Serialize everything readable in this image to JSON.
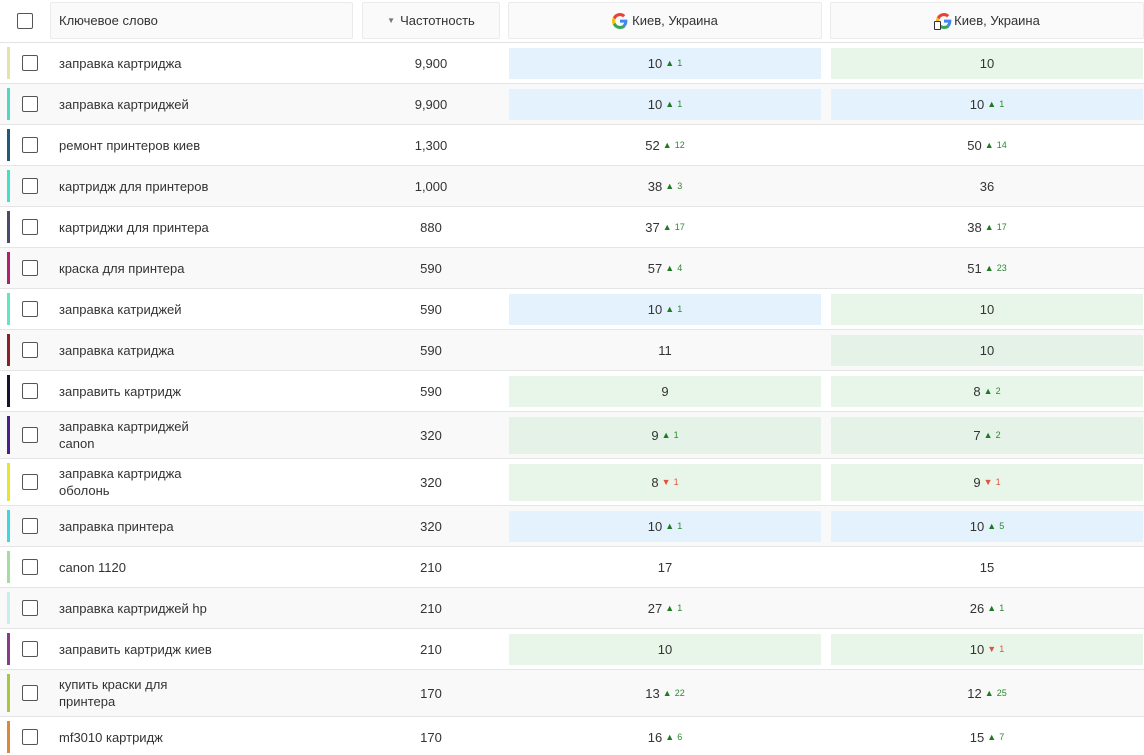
{
  "header": {
    "keyword_label": "Ключевое слово",
    "frequency_label": "Частотность",
    "location1_label": "Киев, Украина",
    "location2_label": "Киев, Украина"
  },
  "colors": {
    "blue_cell": "#e3f2fc",
    "green_cell": "#e8f6ea",
    "up": "#1f7a24",
    "down": "#e0533f"
  },
  "rows": [
    {
      "keyword": "заправка картриджа",
      "freq": "9,900",
      "color": "#e8e2a6",
      "p1": {
        "pos": "10",
        "chg": "1",
        "dir": "up",
        "bg": "blue"
      },
      "p2": {
        "pos": "10",
        "chg": "",
        "dir": "",
        "bg": "green"
      }
    },
    {
      "keyword": "заправка картриджей",
      "freq": "9,900",
      "color": "#4dd9c2",
      "p1": {
        "pos": "10",
        "chg": "1",
        "dir": "up",
        "bg": "blue"
      },
      "p2": {
        "pos": "10",
        "chg": "1",
        "dir": "up",
        "bg": "blue"
      }
    },
    {
      "keyword": "ремонт принтеров киев",
      "freq": "1,300",
      "color": "#1f5a7a",
      "p1": {
        "pos": "52",
        "chg": "12",
        "dir": "up",
        "bg": ""
      },
      "p2": {
        "pos": "50",
        "chg": "14",
        "dir": "up",
        "bg": ""
      }
    },
    {
      "keyword": "картридж для принтеров",
      "freq": "1,000",
      "color": "#41e0c8",
      "p1": {
        "pos": "38",
        "chg": "3",
        "dir": "up",
        "bg": ""
      },
      "p2": {
        "pos": "36",
        "chg": "",
        "dir": "",
        "bg": ""
      }
    },
    {
      "keyword": "картриджи для принтера",
      "freq": "880",
      "color": "#4a4a6a",
      "p1": {
        "pos": "37",
        "chg": "17",
        "dir": "up",
        "bg": ""
      },
      "p2": {
        "pos": "38",
        "chg": "17",
        "dir": "up",
        "bg": ""
      }
    },
    {
      "keyword": "краска для принтера",
      "freq": "590",
      "color": "#b0206e",
      "p1": {
        "pos": "57",
        "chg": "4",
        "dir": "up",
        "bg": ""
      },
      "p2": {
        "pos": "51",
        "chg": "23",
        "dir": "up",
        "bg": ""
      }
    },
    {
      "keyword": "заправка катриджей",
      "freq": "590",
      "color": "#5ee8c0",
      "p1": {
        "pos": "10",
        "chg": "1",
        "dir": "up",
        "bg": "blue"
      },
      "p2": {
        "pos": "10",
        "chg": "",
        "dir": "",
        "bg": "green"
      }
    },
    {
      "keyword": "заправка катриджа",
      "freq": "590",
      "color": "#8a1f2a",
      "p1": {
        "pos": "11",
        "chg": "",
        "dir": "",
        "bg": ""
      },
      "p2": {
        "pos": "10",
        "chg": "",
        "dir": "",
        "bg": "dgreen"
      }
    },
    {
      "keyword": "заправить картридж",
      "freq": "590",
      "color": "#141432",
      "p1": {
        "pos": "9",
        "chg": "",
        "dir": "",
        "bg": "green"
      },
      "p2": {
        "pos": "8",
        "chg": "2",
        "dir": "up",
        "bg": "green"
      }
    },
    {
      "keyword": "заправка картриджей canon",
      "freq": "320",
      "color": "#4b1e8a",
      "p1": {
        "pos": "9",
        "chg": "1",
        "dir": "up",
        "bg": "dgreen"
      },
      "p2": {
        "pos": "7",
        "chg": "2",
        "dir": "up",
        "bg": "dgreen"
      }
    },
    {
      "keyword": "заправка картриджа оболонь",
      "freq": "320",
      "color": "#e6e62a",
      "p1": {
        "pos": "8",
        "chg": "1",
        "dir": "down",
        "bg": "green"
      },
      "p2": {
        "pos": "9",
        "chg": "1",
        "dir": "down",
        "bg": "green"
      }
    },
    {
      "keyword": "заправка принтера",
      "freq": "320",
      "color": "#3ad8e0",
      "p1": {
        "pos": "10",
        "chg": "1",
        "dir": "up",
        "bg": "blue"
      },
      "p2": {
        "pos": "10",
        "chg": "5",
        "dir": "up",
        "bg": "blue"
      }
    },
    {
      "keyword": "canon 1120",
      "freq": "210",
      "color": "#a6dca0",
      "p1": {
        "pos": "17",
        "chg": "",
        "dir": "",
        "bg": ""
      },
      "p2": {
        "pos": "15",
        "chg": "",
        "dir": "",
        "bg": ""
      }
    },
    {
      "keyword": "заправка картриджей hp",
      "freq": "210",
      "color": "#c8eef2",
      "p1": {
        "pos": "27",
        "chg": "1",
        "dir": "up",
        "bg": ""
      },
      "p2": {
        "pos": "26",
        "chg": "1",
        "dir": "up",
        "bg": ""
      }
    },
    {
      "keyword": "заправить картридж киев",
      "freq": "210",
      "color": "#8a3a8a",
      "p1": {
        "pos": "10",
        "chg": "",
        "dir": "",
        "bg": "green"
      },
      "p2": {
        "pos": "10",
        "chg": "1",
        "dir": "down",
        "bg": "green"
      }
    },
    {
      "keyword": "купить краски для принтера",
      "freq": "170",
      "color": "#a6c83a",
      "p1": {
        "pos": "13",
        "chg": "22",
        "dir": "up",
        "bg": ""
      },
      "p2": {
        "pos": "12",
        "chg": "25",
        "dir": "up",
        "bg": ""
      }
    },
    {
      "keyword": "mf3010 картридж",
      "freq": "170",
      "color": "#d88a3a",
      "p1": {
        "pos": "16",
        "chg": "6",
        "dir": "up",
        "bg": ""
      },
      "p2": {
        "pos": "15",
        "chg": "7",
        "dir": "up",
        "bg": ""
      }
    }
  ]
}
